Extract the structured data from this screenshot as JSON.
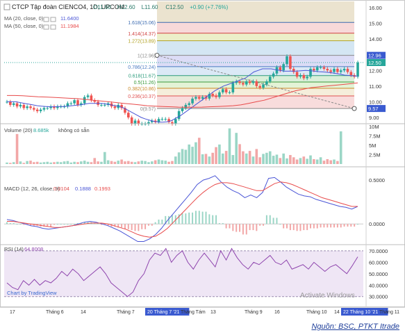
{
  "header": {
    "symbol": "CTCP Tập đoàn CIENCO4, 1D, UPCOM",
    "ohlc": [
      "O11.60",
      "H12.60",
      "L11.60",
      "C12.50",
      "+0.90 (+7.76%)"
    ],
    "ma20": "MA (20, close, 0)",
    "ma20_value": "11.6400",
    "ma50": "MA (50, close, 0)",
    "ma50_value": "11.1984"
  },
  "volume_header": {
    "label": "Volume (20)",
    "value": "8.685k",
    "note": "không có sẵn"
  },
  "macd_header": {
    "label": "MACD (12, 26, close, 9)",
    "v1": "0.0104",
    "v2": "0.1888",
    "v3": "0.1993"
  },
  "rsi_header": {
    "label": "RSI (14)",
    "value": "64.8008"
  },
  "fib_labels": [
    "1(12.96)",
    "0.786(12.24)",
    "0.618(11.67)",
    "0.5(11.26)",
    "0.382(10.86)",
    "0.236(10.37)",
    "0(9.57)",
    "1.272(13.89)",
    "1.414(14.37)",
    "1.618(15.06)"
  ],
  "x_labels": [
    "17",
    "Tháng 6",
    "14",
    "Tháng 7",
    "20 Tháng 7 '21",
    "Tháng Tám",
    "13",
    "Tháng 9",
    "16",
    "Tháng 10",
    "14",
    "22 Tháng 10 '21",
    "Tháng 11"
  ],
  "watermark": "Chart by TradingView",
  "activate_text": "Activate Windows",
  "source": "Nguồn: BSC, PTKT Itrade",
  "colors": {
    "up": "#26a69a",
    "down": "#ef5350",
    "ma20": "#4a55d6",
    "ma50": "#e84a4a",
    "macd": "#4a55d6",
    "signal": "#e84a4a",
    "rsi": "#8e44ad"
  },
  "chart_data": [
    {
      "type": "candlestick",
      "title": "CTCP Tập đoàn CIENCO4, 1D, UPCOM",
      "ylim": [
        8.6,
        16.4
      ],
      "yticks": [
        9.0,
        10.0,
        11.0,
        12.0,
        13.0,
        14.0,
        15.0,
        16.0
      ],
      "current_labels": [
        "12.96",
        "12.50",
        "9.57"
      ],
      "close": [
        10.0,
        9.8,
        9.9,
        9.7,
        9.8,
        9.6,
        9.7,
        9.6,
        9.5,
        9.4,
        9.5,
        9.6,
        9.6,
        9.7,
        9.6,
        9.7,
        9.7,
        9.7,
        9.9,
        9.9,
        10.1,
        9.8,
        9.9,
        10.3,
        10.4,
        10.1,
        10.0,
        9.8,
        9.8,
        9.8,
        9.9,
        9.7,
        9.6,
        9.8,
        9.6,
        9.3,
        9.0,
        8.6,
        8.8,
        8.6,
        8.6,
        8.6,
        8.7,
        8.8,
        8.7,
        8.9,
        8.9,
        8.9,
        8.7,
        8.6,
        8.9,
        9.4,
        9.6,
        9.8,
        9.9,
        10.2,
        10.3,
        10.2,
        10.3,
        10.2,
        10.5,
        10.4,
        10.3,
        10.6,
        10.8,
        10.6,
        10.6,
        11.2,
        11.3,
        11.2,
        11.1,
        11.3,
        11.2,
        11.3,
        11.0,
        10.9,
        11.1,
        11.3,
        11.6,
        11.8,
        12.2,
        12.0,
        12.4,
        12.9,
        12.1,
        11.9,
        11.6,
        11.7,
        11.5,
        11.6,
        12.1,
        12.0,
        12.2,
        12.2,
        12.1,
        12.0,
        11.9,
        12.1,
        11.9,
        12.0,
        12.1,
        11.9,
        11.7,
        11.6,
        12.5
      ],
      "ma20": [
        10.0,
        10.0,
        10.0,
        9.95,
        9.9,
        9.85,
        9.8,
        9.75,
        9.72,
        9.7,
        9.68,
        9.68,
        9.7,
        9.7,
        9.72,
        9.75,
        9.78,
        9.8,
        9.85,
        9.9,
        9.9,
        9.9,
        9.9,
        9.85,
        9.8,
        9.75,
        9.7,
        9.6,
        9.45,
        9.3,
        9.15,
        9.0,
        8.9,
        8.82,
        8.75,
        8.7,
        8.7,
        8.72,
        8.8,
        8.95,
        9.1,
        9.3,
        9.5,
        9.7,
        9.9,
        10.1,
        10.3,
        10.5,
        10.7,
        10.85,
        11.0,
        11.1,
        11.2,
        11.3,
        11.4,
        11.5,
        11.7,
        11.9,
        12.0,
        12.1,
        12.1,
        12.1,
        12.05,
        12.0,
        11.95,
        11.95,
        11.95,
        11.96,
        11.98,
        12.0,
        11.98,
        11.95,
        11.92,
        11.9,
        11.88,
        11.85,
        11.8,
        11.75,
        11.7,
        11.68,
        11.65,
        11.64
      ],
      "ma50": [
        10.4,
        10.4,
        10.38,
        10.35,
        10.32,
        10.3,
        10.28,
        10.25,
        10.22,
        10.2,
        10.15,
        10.1,
        10.05,
        10.0,
        9.95,
        9.9,
        9.85,
        9.8,
        9.75,
        9.72,
        9.7,
        9.68,
        9.66,
        9.65,
        9.65,
        9.66,
        9.68,
        9.7,
        9.72,
        9.75,
        9.8,
        9.9,
        10.0,
        10.1,
        10.25,
        10.4,
        10.55,
        10.7,
        10.8,
        10.9,
        10.95,
        11.0,
        11.05,
        11.1,
        11.15,
        11.2
      ],
      "fib_levels": [
        {
          "ratio": "0",
          "value": 9.57
        },
        {
          "ratio": "0.236",
          "value": 10.37
        },
        {
          "ratio": "0.382",
          "value": 10.86
        },
        {
          "ratio": "0.5",
          "value": 11.26
        },
        {
          "ratio": "0.618",
          "value": 11.67
        },
        {
          "ratio": "0.786",
          "value": 12.24
        },
        {
          "ratio": "1",
          "value": 12.96
        },
        {
          "ratio": "1.272",
          "value": 13.89
        },
        {
          "ratio": "1.414",
          "value": 14.37
        },
        {
          "ratio": "1.618",
          "value": 15.06
        }
      ]
    },
    {
      "type": "bar",
      "title": "Volume (20)",
      "ylim": [
        0,
        10
      ],
      "yticks": [
        "2.5M",
        "5M",
        "7.5M",
        "10M"
      ],
      "values": [
        0.4,
        0.3,
        0.5,
        8.0,
        0.7,
        0.3,
        0.8,
        0.9,
        0.5,
        0.6,
        0.4,
        0.5,
        0.6,
        0.4,
        0.5,
        0.6,
        0.5,
        0.7,
        0.8,
        0.4,
        0.6,
        0.5,
        0.7,
        0.9,
        0.6,
        0.5,
        1.6,
        0.7,
        0.6,
        3.2,
        1.0,
        0.8,
        0.6,
        0.9,
        1.2,
        0.7,
        0.8,
        0.6,
        0.5,
        0.7,
        0.9,
        0.8,
        0.5,
        0.7,
        1.0,
        1.2,
        1.0,
        0.9,
        0.6,
        0.8,
        2.0,
        3.1,
        4.0,
        3.8,
        5.2,
        4.6,
        5.8,
        7.0,
        2.6,
        2.7,
        2.0,
        3.0,
        4.5,
        5.2,
        2.8,
        3.5,
        9.5,
        2.4,
        8.3,
        5.3,
        3.4,
        2.8,
        3.5,
        2.0,
        4.0,
        1.8,
        2.7,
        3.0,
        3.4,
        2.2,
        2.5,
        1.6,
        2.8,
        1.5,
        2.4,
        1.8,
        1.2,
        1.6,
        2.0,
        1.4,
        2.3,
        1.3,
        1.2,
        1.8,
        0.9,
        1.3,
        1.0,
        1.2,
        0.8,
        8.7
      ]
    },
    {
      "type": "line",
      "title": "MACD (12, 26, close, 9)",
      "ylim": [
        -0.22,
        0.62
      ],
      "yticks": [
        "0.0000",
        "0.5000"
      ],
      "macd": [
        0.05,
        0.04,
        0.02,
        0.0,
        -0.02,
        -0.03,
        -0.05,
        -0.06,
        -0.05,
        -0.04,
        -0.03,
        -0.02,
        0.0,
        0.02,
        0.03,
        0.02,
        0.0,
        -0.02,
        -0.05,
        -0.08,
        -0.12,
        -0.16,
        -0.2,
        -0.2,
        -0.17,
        -0.12,
        -0.05,
        0.04,
        0.12,
        0.2,
        0.28,
        0.36,
        0.45,
        0.5,
        0.52,
        0.55,
        0.48,
        0.42,
        0.38,
        0.35,
        0.3,
        0.33,
        0.3,
        0.36,
        0.52,
        0.53,
        0.48,
        0.42,
        0.38,
        0.34,
        0.32,
        0.31,
        0.28,
        0.26,
        0.24,
        0.22,
        0.2,
        0.19,
        0.17,
        0.2
      ],
      "signal": [
        0.03,
        0.03,
        0.02,
        0.01,
        0.0,
        -0.01,
        -0.02,
        -0.03,
        -0.04,
        -0.04,
        -0.03,
        -0.02,
        -0.01,
        0.0,
        0.01,
        0.01,
        0.01,
        0.0,
        -0.02,
        -0.04,
        -0.06,
        -0.09,
        -0.12,
        -0.14,
        -0.15,
        -0.14,
        -0.1,
        -0.05,
        0.02,
        0.09,
        0.16,
        0.23,
        0.3,
        0.36,
        0.41,
        0.45,
        0.47,
        0.47,
        0.46,
        0.44,
        0.42,
        0.4,
        0.38,
        0.38,
        0.42,
        0.46,
        0.48,
        0.47,
        0.45,
        0.42,
        0.39,
        0.36,
        0.33,
        0.3,
        0.28,
        0.26,
        0.24,
        0.22,
        0.2,
        0.2
      ]
    },
    {
      "type": "line",
      "title": "RSI (14)",
      "ylim": [
        28,
        73
      ],
      "yticks": [
        "30.0000",
        "40.0000",
        "50.0000",
        "60.0000",
        "70.0000"
      ],
      "overbought": 70,
      "oversold": 30,
      "values": [
        42,
        38,
        36,
        44,
        40,
        45,
        40,
        44,
        42,
        46,
        52,
        48,
        54,
        50,
        44,
        48,
        52,
        56,
        50,
        42,
        38,
        34,
        30,
        34,
        44,
        50,
        62,
        68,
        66,
        72,
        60,
        66,
        70,
        60,
        54,
        62,
        68,
        62,
        56,
        70,
        62,
        72,
        64,
        58,
        54,
        60,
        58,
        62,
        66,
        60,
        58,
        62,
        54,
        56,
        58,
        54,
        60,
        56,
        52,
        56,
        58,
        54,
        50,
        57,
        64.8
      ]
    }
  ]
}
